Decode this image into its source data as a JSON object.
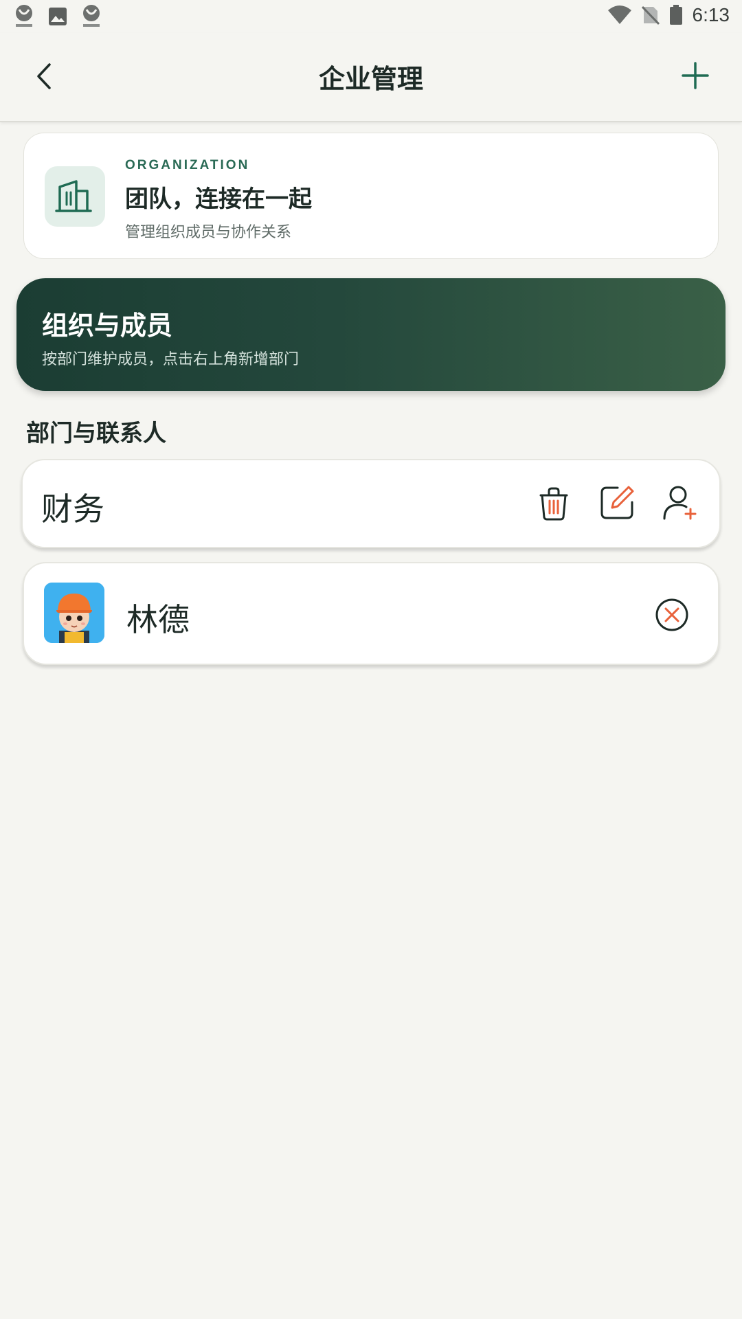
{
  "status_bar": {
    "time": "6:13",
    "icons": [
      "app-icon",
      "image-icon",
      "app-icon",
      "wifi-icon",
      "no-sim-icon",
      "battery-icon"
    ]
  },
  "header": {
    "title": "企业管理",
    "back_icon": "chevron-left-icon",
    "add_icon": "plus-icon"
  },
  "org_card": {
    "kicker": "ORGANIZATION",
    "title": "团队，连接在一起",
    "subtitle": "管理组织成员与协作关系",
    "icon": "building-icon"
  },
  "banner": {
    "title": "组织与成员",
    "subtitle": "按部门维护成员，点击右上角新增部门"
  },
  "section": {
    "title": "部门与联系人"
  },
  "department": {
    "name": "财务",
    "actions": [
      "trash-icon",
      "edit-icon",
      "add-user-icon"
    ]
  },
  "member": {
    "name": "林德",
    "avatar": "avatar",
    "remove_icon": "remove-circle-icon"
  },
  "colors": {
    "accent": "#1f6b53",
    "danger": "#e8613a",
    "background": "#f5f5f1",
    "banner_dark": "#1b3d33",
    "banner_light": "#3a6047"
  }
}
